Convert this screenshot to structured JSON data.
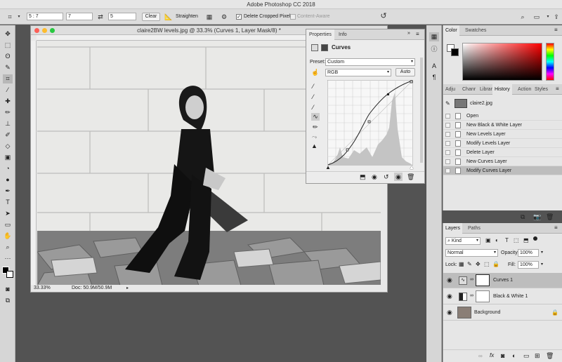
{
  "app": {
    "title": "Adobe Photoshop CC 2018"
  },
  "options": {
    "ratio": "5 : 7",
    "width": "7",
    "height": "5",
    "clear": "Clear",
    "straighten": "Straighten",
    "delete_cropped": "Delete Cropped Pixels",
    "content_aware": "Content-Aware"
  },
  "document": {
    "title": "claire2BW levels.jpg @ 33.3% (Curves 1, Layer Mask/8) *",
    "zoom": "33.33%",
    "doc_size": "Doc: 50.9M/50.9M"
  },
  "properties": {
    "tabs": [
      "Properties",
      "Info"
    ],
    "heading": "Curves",
    "preset_label": "Preset:",
    "preset_value": "Custom",
    "channel": "RGB",
    "auto": "Auto"
  },
  "color_panel": {
    "tabs": [
      "Color",
      "Swatches"
    ]
  },
  "history_panel": {
    "tabs": [
      "Adju",
      "Chanr",
      "Librar",
      "History",
      "Action",
      "Styles"
    ],
    "snapshot": "claire2.jpg",
    "items": [
      "Open",
      "New Black & White Layer",
      "New Levels Layer",
      "Modify Levels Layer",
      "Delete Layer",
      "New Curves Layer",
      "Modify Curves Layer"
    ]
  },
  "layers_panel": {
    "tabs": [
      "Layers",
      "Paths"
    ],
    "kind": "Kind",
    "blend_mode": "Normal",
    "opacity_label": "Opacity:",
    "opacity": "100%",
    "lock_label": "Lock:",
    "fill_label": "Fill:",
    "fill": "100%",
    "layers": [
      "Curves 1",
      "Black & White 1",
      "Background"
    ]
  },
  "colors": {
    "accent_hue": "#ff0000",
    "selected_row": "#bdbdbd"
  }
}
